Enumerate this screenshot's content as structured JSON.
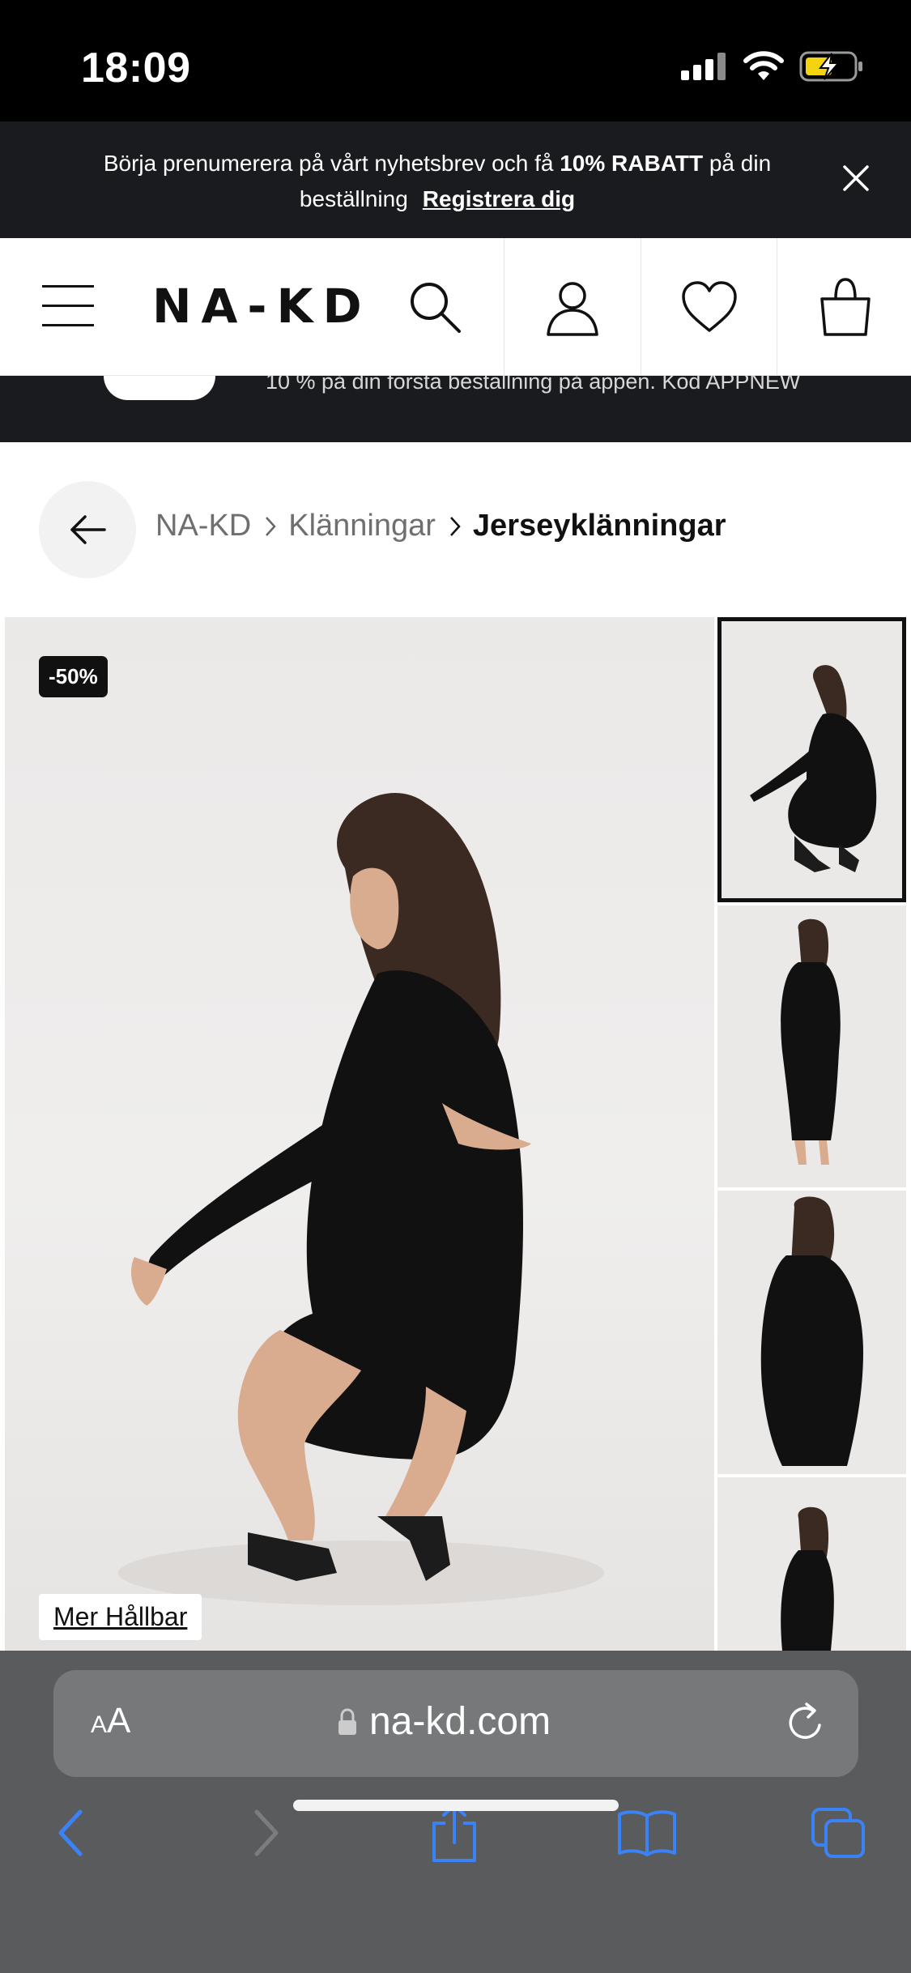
{
  "status_bar": {
    "time": "18:09"
  },
  "newsletter": {
    "text_before": "Börja prenumerera på vårt nyhetsbrev och få ",
    "discount": "10% RABATT",
    "text_after": " på din beställning",
    "link": "Registrera dig"
  },
  "header": {
    "logo": "NA-KD"
  },
  "promo": {
    "text": "10 % på din första beställning på appen. Kod APPNEW"
  },
  "breadcrumb": {
    "items": [
      "NA-KD",
      "Klänningar"
    ],
    "current": "Jerseyklänningar"
  },
  "product": {
    "badge": "-50%",
    "sustainability_label": "Mer Hållbar"
  },
  "browser": {
    "text_size_label": "AA",
    "url": "na-kd.com"
  },
  "colors": {
    "banner_bg": "#1a1b1e",
    "browser_bg": "#5a5b5c",
    "ios_blue": "#3b82f6"
  }
}
